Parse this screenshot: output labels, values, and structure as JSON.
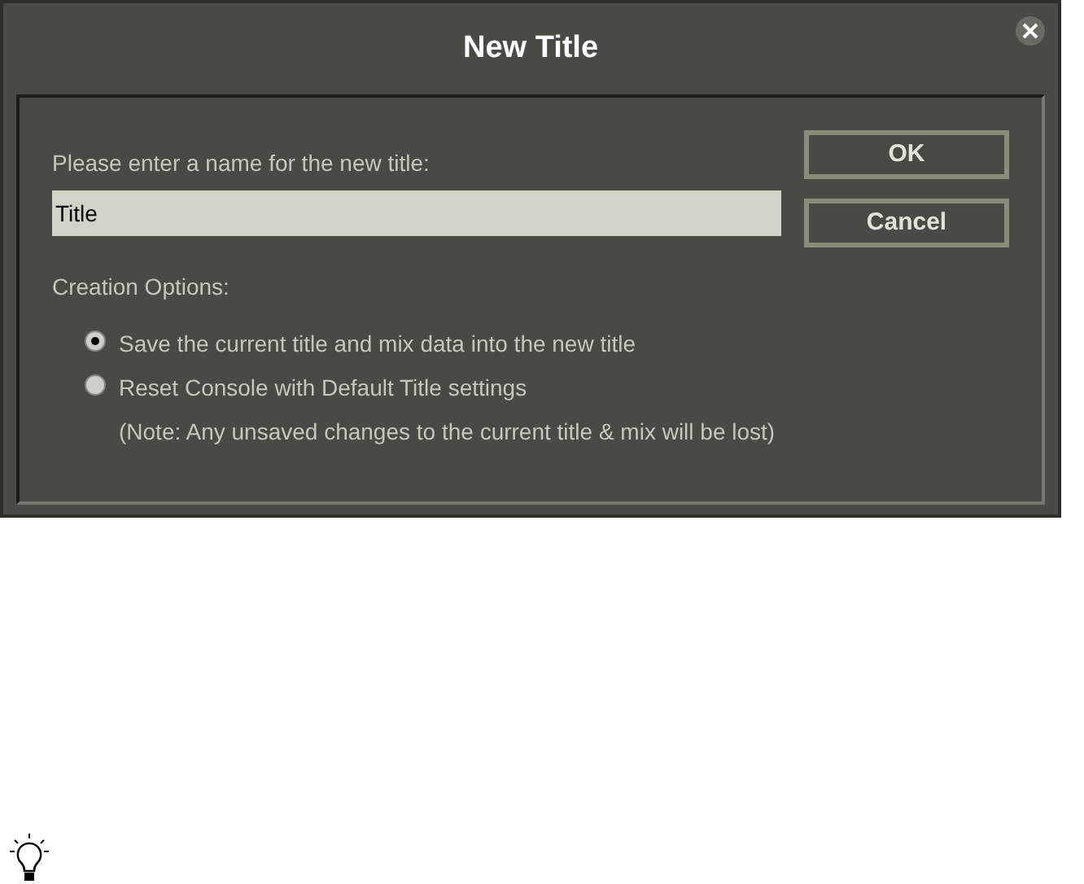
{
  "dialog": {
    "title": "New Title",
    "prompt": "Please enter a name for the new title:",
    "name_field": {
      "value": "Title"
    },
    "buttons": [
      "OK",
      "Cancel"
    ],
    "options_label": "Creation Options:",
    "options": [
      {
        "label": "Save the current title and mix data into the new title",
        "selected": true
      },
      {
        "label": "Reset Console with Default Title settings",
        "note": "(Note: Any unsaved changes to the current title & mix will be lost)",
        "selected": false
      }
    ]
  }
}
